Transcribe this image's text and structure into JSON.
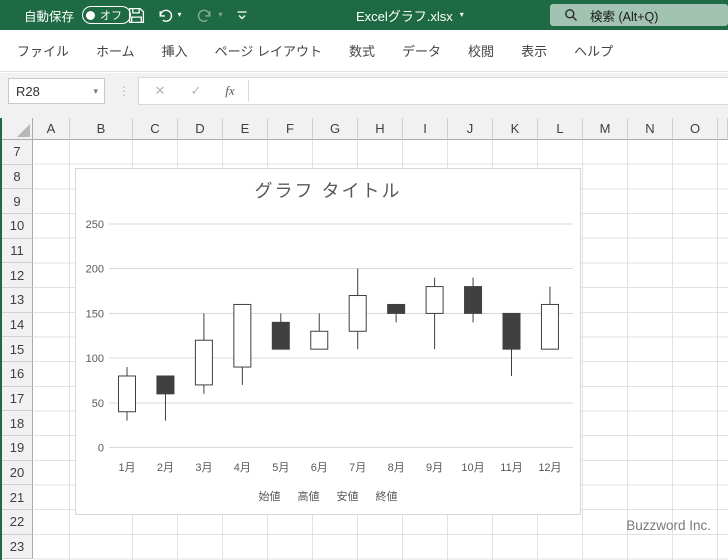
{
  "titlebar": {
    "autosave_label": "自動保存",
    "autosave_state": "オフ",
    "doc_title": "Excelグラフ.xlsx",
    "search_label": "検索 (Alt+Q)"
  },
  "ribbon": {
    "tabs": [
      "ファイル",
      "ホーム",
      "挿入",
      "ページ レイアウト",
      "数式",
      "データ",
      "校閲",
      "表示",
      "ヘルプ"
    ]
  },
  "formula_bar": {
    "name_box_value": "R28",
    "cancel_label": "✕",
    "enter_label": "✓",
    "fx_label": "fx",
    "formula_value": ""
  },
  "sheet": {
    "column_headers": [
      "A",
      "B",
      "C",
      "D",
      "E",
      "F",
      "G",
      "H",
      "I",
      "J",
      "K",
      "L",
      "M",
      "N",
      "O"
    ],
    "row_headers": [
      "7",
      "8",
      "9",
      "10",
      "11",
      "12",
      "13",
      "14",
      "15",
      "16",
      "17",
      "18",
      "19",
      "20",
      "21",
      "22",
      "23"
    ],
    "watermark": "Buzzword Inc."
  },
  "chart_data": {
    "type": "candlestick",
    "title": "グラフ タイトル",
    "categories": [
      "1月",
      "2月",
      "3月",
      "4月",
      "5月",
      "6月",
      "7月",
      "8月",
      "9月",
      "10月",
      "11月",
      "12月"
    ],
    "series": [
      {
        "name": "始値",
        "values": [
          40,
          80,
          70,
          90,
          140,
          110,
          130,
          160,
          150,
          180,
          150,
          110
        ]
      },
      {
        "name": "高値",
        "values": [
          90,
          80,
          150,
          160,
          150,
          150,
          200,
          160,
          190,
          190,
          150,
          180
        ]
      },
      {
        "name": "安値",
        "values": [
          30,
          30,
          60,
          70,
          110,
          110,
          110,
          140,
          110,
          140,
          80,
          110
        ]
      },
      {
        "name": "終値",
        "values": [
          80,
          60,
          120,
          160,
          110,
          130,
          170,
          150,
          180,
          150,
          110,
          160
        ]
      }
    ],
    "ylim": [
      0,
      250
    ],
    "yticks": [
      0,
      50,
      100,
      150,
      200,
      250
    ],
    "legend_position": "bottom",
    "grid": "horizontal",
    "colors": {
      "up_fill": "#ffffff",
      "down_fill": "#404040",
      "stroke": "#404040",
      "gridline": "#d9d9d9",
      "text": "#595959"
    }
  }
}
